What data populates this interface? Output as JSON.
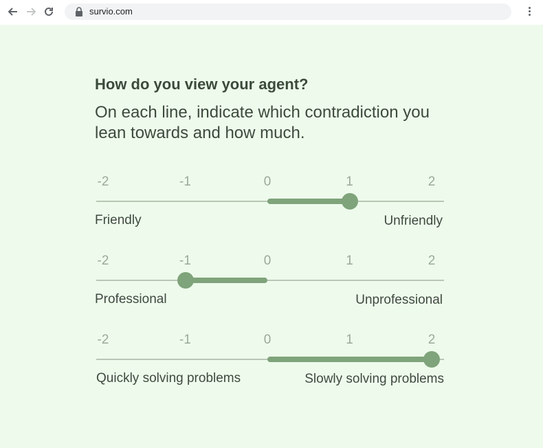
{
  "browser": {
    "url": "survio.com",
    "icons": [
      "back-arrow-icon",
      "forward-arrow-icon",
      "reload-icon",
      "lock-icon",
      "kebab-menu-icon"
    ]
  },
  "question": {
    "title": "How do you view your agent?",
    "subtitle": "On each line, indicate which contradiction you lean towards and how much."
  },
  "scale_ticks": [
    "-2",
    "-1",
    "0",
    "1",
    "2"
  ],
  "sliders": [
    {
      "left_label": "Friendly",
      "right_label": "Unfriendly",
      "value": 1
    },
    {
      "left_label": "Professional",
      "right_label": "Unprofessional",
      "value": -1
    },
    {
      "left_label": "Quickly solving problems",
      "right_label": "Slowly solving problems",
      "value": 2
    }
  ],
  "colors": {
    "page_background": "#eefbec",
    "slider_accent": "#7fa37a",
    "track": "#b8c6b6",
    "tick_text": "#9aaa99"
  }
}
